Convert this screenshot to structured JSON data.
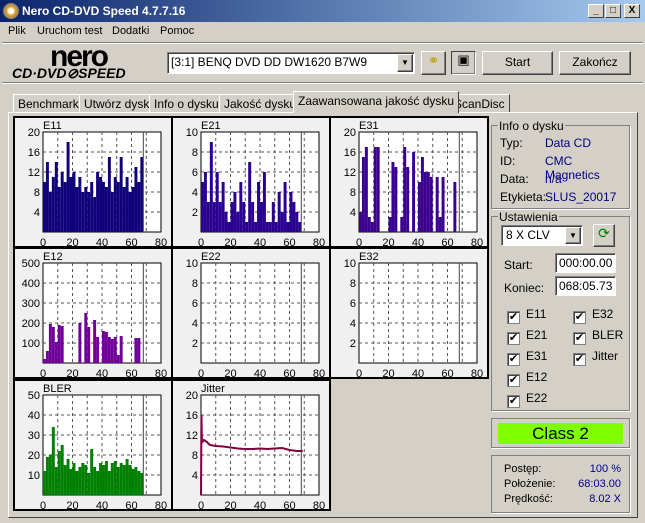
{
  "window": {
    "title": "Nero CD-DVD Speed 4.7.7.16",
    "minimize": "_",
    "maximize": "□",
    "close": "X"
  },
  "menu": [
    "Plik",
    "Uruchom test",
    "Dodatki",
    "Pomoc"
  ],
  "logo": {
    "line1": "nero",
    "line2": "CD·DVD⊘SPEED"
  },
  "toolbar": {
    "drive": "[3:1]   BENQ DVD DD DW1620 B7W9",
    "start": "Start",
    "exit": "Zakończ"
  },
  "tabs": [
    "Benchmark",
    "Utwórz dysk",
    "Info o dysku",
    "Jakość dysku",
    "Zaawansowana jakość dysku",
    "ScanDisc"
  ],
  "active_tab": 4,
  "disc_info": {
    "title": "Info o dysku",
    "rows": [
      {
        "k": "Typ:",
        "v": "Data CD"
      },
      {
        "k": "ID:",
        "v": "CMC Magnetics"
      },
      {
        "k": "Data:",
        "v": "n/a"
      },
      {
        "k": "Etykieta:",
        "v": "SLUS_20017"
      }
    ]
  },
  "settings": {
    "title": "Ustawienia",
    "speed": "8 X CLV",
    "start_label": "Start:",
    "start": "000:00.00",
    "end_label": "Koniec:",
    "end": "068:05.73",
    "checks": [
      {
        "l": "E11",
        "c": true
      },
      {
        "l": "E21",
        "c": true
      },
      {
        "l": "E31",
        "c": true
      },
      {
        "l": "E12",
        "c": true
      },
      {
        "l": "E22",
        "c": true
      },
      {
        "l": "E32",
        "c": true
      },
      {
        "l": "BLER",
        "c": true
      },
      {
        "l": "Jitter",
        "c": true
      }
    ]
  },
  "class": {
    "label": "Class 2",
    "color": "#80ff00"
  },
  "status": {
    "rows": [
      {
        "k": "Postęp:",
        "v": "100 %"
      },
      {
        "k": "Położenie:",
        "v": "68:03.00"
      },
      {
        "k": "Prędkość:",
        "v": "8.02 X"
      }
    ]
  },
  "chart_data": [
    {
      "title": "E11",
      "type": "bar",
      "color": "#10007a",
      "xlim": [
        0,
        80
      ],
      "ylim": [
        0,
        20
      ],
      "yticks": [
        4,
        8,
        12,
        16,
        20
      ],
      "xticks": [
        0,
        20,
        40,
        60,
        80
      ],
      "end_marker": 68,
      "bin": 2,
      "values": [
        10,
        14,
        8,
        11,
        14,
        9,
        12,
        10,
        18,
        11,
        12,
        9,
        11,
        8,
        9,
        8,
        10,
        7,
        12,
        11,
        10,
        9,
        15,
        8,
        11,
        10,
        15,
        9,
        11,
        8,
        9,
        13,
        10,
        15
      ]
    },
    {
      "title": "E21",
      "type": "bar",
      "color": "#2a0090",
      "xlim": [
        0,
        80
      ],
      "ylim": [
        0,
        10
      ],
      "yticks": [
        2,
        4,
        6,
        8,
        10
      ],
      "xticks": [
        0,
        20,
        40,
        60,
        80
      ],
      "end_marker": 68,
      "bin": 2,
      "values": [
        5,
        6,
        3,
        9,
        3,
        6,
        3,
        5,
        2,
        1,
        3,
        4,
        2,
        5,
        3,
        1,
        7,
        3,
        1,
        5,
        3,
        6,
        1,
        1,
        3,
        1,
        4,
        2,
        5,
        1,
        4,
        3,
        2,
        1
      ]
    },
    {
      "title": "E31",
      "type": "bar",
      "color": "#3a0090",
      "xlim": [
        0,
        80
      ],
      "ylim": [
        0,
        20
      ],
      "yticks": [
        4,
        8,
        12,
        16,
        20
      ],
      "xticks": [
        0,
        20,
        40,
        60,
        80
      ],
      "end_marker": 68,
      "bin": 2,
      "values": [
        4,
        15,
        17,
        3,
        2,
        17,
        17,
        0,
        0,
        0,
        3,
        14,
        13,
        0,
        3,
        17,
        13,
        0,
        16,
        0,
        10,
        15,
        12,
        12,
        11,
        0,
        11,
        3,
        11,
        0,
        0,
        0,
        10,
        0
      ]
    },
    {
      "title": "E12",
      "type": "bar",
      "color": "#70009a",
      "xlim": [
        0,
        80
      ],
      "ylim": [
        0,
        500
      ],
      "yticks": [
        100,
        200,
        300,
        400,
        500
      ],
      "xticks": [
        0,
        20,
        40,
        60,
        80
      ],
      "end_marker": 68,
      "bin": 2,
      "values": [
        20,
        60,
        195,
        180,
        105,
        190,
        185,
        0,
        0,
        0,
        0,
        0,
        200,
        0,
        250,
        180,
        0,
        215,
        130,
        0,
        160,
        155,
        130,
        120,
        130,
        40,
        135,
        0,
        0,
        0,
        0,
        125,
        125,
        0
      ]
    },
    {
      "title": "E22",
      "type": "bar",
      "color": "#2a0090",
      "xlim": [
        0,
        80
      ],
      "ylim": [
        0,
        10
      ],
      "yticks": [
        2,
        4,
        6,
        8,
        10
      ],
      "xticks": [
        0,
        20,
        40,
        60,
        80
      ],
      "end_marker": 68,
      "bin": 2,
      "values": []
    },
    {
      "title": "E32",
      "type": "bar",
      "color": "#2a0090",
      "xlim": [
        0,
        80
      ],
      "ylim": [
        0,
        10
      ],
      "yticks": [
        2,
        4,
        6,
        8,
        10
      ],
      "xticks": [
        0,
        20,
        40,
        60,
        80
      ],
      "end_marker": 68,
      "bin": 2,
      "values": []
    },
    {
      "title": "BLER",
      "type": "bar",
      "color": "#008000",
      "xlim": [
        0,
        80
      ],
      "ylim": [
        0,
        50
      ],
      "yticks": [
        10,
        20,
        30,
        40,
        50
      ],
      "xticks": [
        0,
        20,
        40,
        60,
        80
      ],
      "end_marker": 68,
      "bin": 2,
      "values": [
        12,
        19,
        20,
        34,
        14,
        22,
        25,
        15,
        18,
        13,
        16,
        12,
        14,
        16,
        15,
        11,
        23,
        14,
        12,
        16,
        15,
        17,
        12,
        16,
        17,
        14,
        16,
        15,
        18,
        15,
        13,
        14,
        12,
        11
      ]
    },
    {
      "title": "Jitter",
      "type": "line",
      "color": "#800040",
      "xlim": [
        0,
        80
      ],
      "ylim": [
        0,
        20
      ],
      "yticks": [
        4,
        8,
        12,
        16,
        20
      ],
      "xticks": [
        0,
        20,
        40,
        60,
        80
      ],
      "end_marker": 68,
      "points": [
        [
          0,
          0
        ],
        [
          0.3,
          16
        ],
        [
          0.6,
          10.5
        ],
        [
          2,
          11
        ],
        [
          4,
          10.6
        ],
        [
          6,
          10
        ],
        [
          10,
          9.8
        ],
        [
          15,
          9.7
        ],
        [
          20,
          9.5
        ],
        [
          25,
          9.3
        ],
        [
          30,
          9.2
        ],
        [
          35,
          9.2
        ],
        [
          40,
          9.3
        ],
        [
          45,
          9.2
        ],
        [
          50,
          9.3
        ],
        [
          55,
          9.4
        ],
        [
          60,
          9
        ],
        [
          65,
          8.8
        ],
        [
          69,
          8.8
        ]
      ]
    }
  ]
}
